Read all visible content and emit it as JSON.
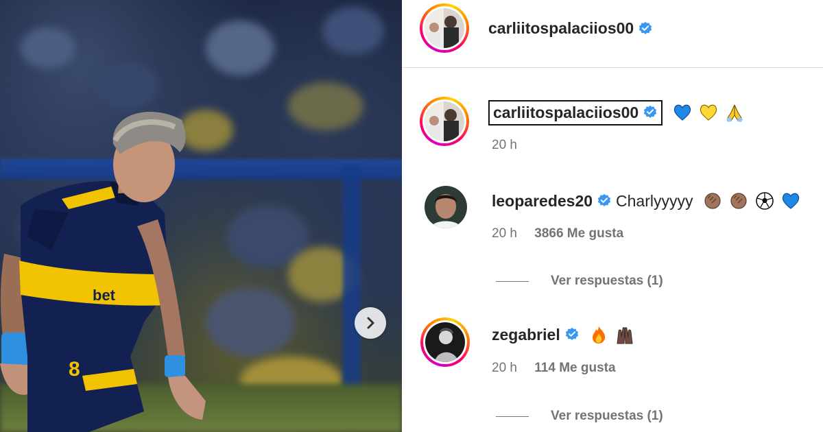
{
  "post": {
    "author": "carliitospalaciios00",
    "colors": {
      "verified": "#3897f0",
      "muted": "#737373",
      "text": "#262626"
    }
  },
  "caption": {
    "username": "carliitospalaciios00",
    "emojis": [
      "blue-heart-icon",
      "yellow-heart-icon",
      "folded-hands-icon"
    ],
    "time": "20 h"
  },
  "comments": [
    {
      "username": "leoparedes20",
      "text": "Charlyyyyy",
      "emojis": [
        "clapping-hands-icon",
        "clapping-hands-icon",
        "soccer-ball-icon",
        "blue-heart-icon"
      ],
      "time": "20 h",
      "likes": "3866 Me gusta",
      "replies": "Ver respuestas (1)"
    },
    {
      "username": "zegabriel",
      "text": "",
      "emojis": [
        "fire-icon",
        "raised-hands-icon"
      ],
      "time": "20 h",
      "likes": "114 Me gusta",
      "replies": "Ver respuestas (1)"
    }
  ],
  "photo": {
    "next_icon": "chevron-right-icon"
  }
}
